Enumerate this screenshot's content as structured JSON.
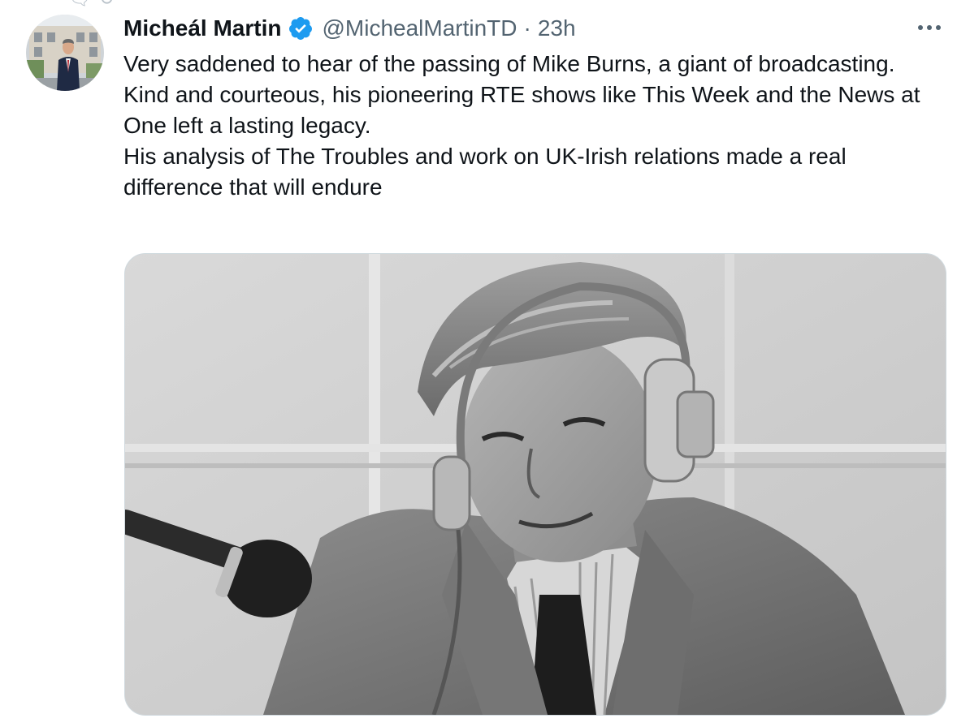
{
  "tweet": {
    "display_name": "Micheál Martin",
    "verified": true,
    "handle": "@MichealMartinTD",
    "separator": "·",
    "timestamp": "23h",
    "text_lines": [
      "Very saddened to hear of the passing of Mike Burns, a giant of broadcasting.",
      "Kind and courteous, his pioneering RTE shows like This Week and the News at One left a lasting legacy.",
      "His analysis of The Troubles and work on UK-Irish relations made a real difference that will endure"
    ],
    "media": {
      "type": "photo",
      "style": "black-and-white"
    }
  },
  "icons": {
    "verified": "verified-badge-icon",
    "more": "more-options-icon"
  },
  "colors": {
    "text_primary": "#0f1419",
    "text_secondary": "#536471",
    "verified_blue": "#1d9bf0",
    "media_border": "#cfd9de"
  }
}
